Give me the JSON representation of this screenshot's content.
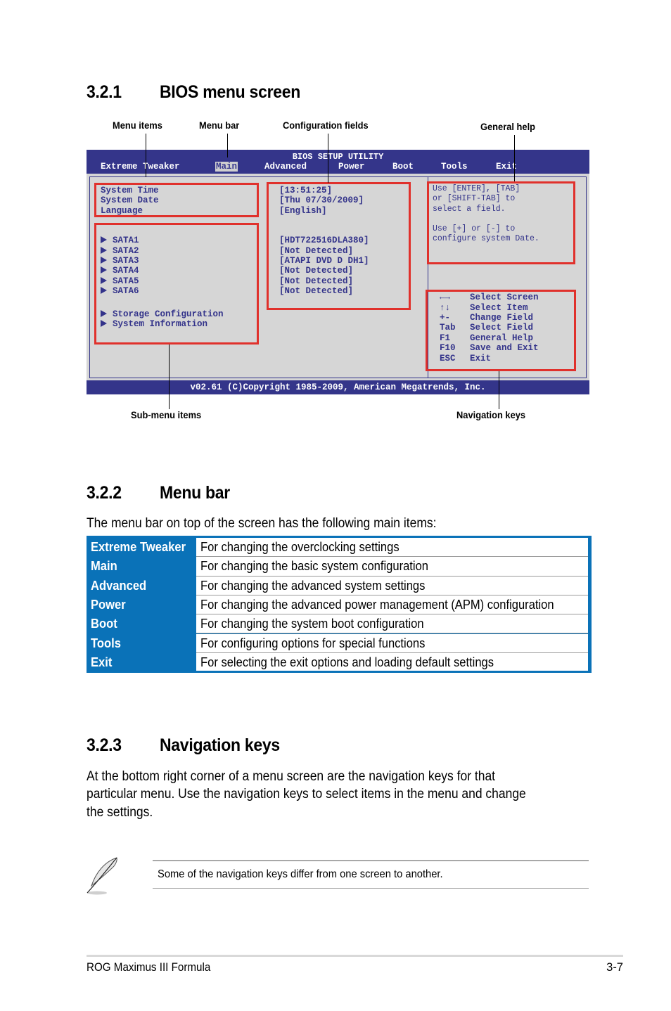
{
  "sections": {
    "bios_menu_screen": {
      "number": "3.2.1",
      "title": "BIOS menu screen"
    },
    "menu_bar": {
      "number": "3.2.2",
      "title": "Menu bar"
    },
    "navigation_keys": {
      "number": "3.2.3",
      "title": "Navigation keys"
    }
  },
  "callouts": {
    "menu_items": "Menu items",
    "menu_bar": "Menu bar",
    "configuration_fields": "Configuration fields",
    "general_help": "General help",
    "sub_menu_items": "Sub-menu items",
    "navigation_keys": "Navigation keys"
  },
  "bios": {
    "title": "BIOS SETUP UTILITY",
    "menu": [
      "Extreme Tweaker",
      "Main",
      "Advanced",
      "Power",
      "Boot",
      "Tools",
      "Exit"
    ],
    "active_menu": "Main",
    "menu_items": [
      "System Time",
      "System Date",
      "Language"
    ],
    "sub_menu_items": [
      "SATA1",
      "SATA2",
      "SATA3",
      "SATA4",
      "SATA5",
      "SATA6"
    ],
    "sub_menu_items_2": [
      "Storage Configuration",
      "System Information"
    ],
    "config_values": [
      "[13:51:25]",
      "[Thu 07/30/2009]",
      "[English]"
    ],
    "sata_values": [
      "[HDT722516DLA380]",
      "[Not Detected]",
      "[ATAPI DVD D DH1]",
      "[Not Detected]",
      "[Not Detected]",
      "[Not Detected]"
    ],
    "general_help": [
      "Use [ENTER], [TAB]",
      "or [SHIFT-TAB] to",
      "select a field.",
      "",
      "Use [+] or [-] to",
      "configure system Date."
    ],
    "nav_keys": [
      {
        "key": "←→",
        "action": "Select Screen"
      },
      {
        "key": "↑↓",
        "action": "Select Item"
      },
      {
        "key": "+-",
        "action": "Change Field"
      },
      {
        "key": "Tab",
        "action": "Select Field"
      },
      {
        "key": "F1",
        "action": "General Help"
      },
      {
        "key": "F10",
        "action": "Save and Exit"
      },
      {
        "key": "ESC",
        "action": "Exit"
      }
    ],
    "footer": "v02.61 (C)Copyright 1985-2009, American Megatrends, Inc."
  },
  "menu_bar_intro": "The menu bar on top of the screen has the following main items:",
  "menu_table": [
    {
      "item": "Extreme Tweaker",
      "description": "For changing the overclocking settings"
    },
    {
      "item": "Main",
      "description": "For changing the basic system configuration"
    },
    {
      "item": "Advanced",
      "description": "For changing the advanced system settings"
    },
    {
      "item": "Power",
      "description": "For changing the advanced power management (APM) configuration"
    },
    {
      "item": "Boot",
      "description": "For changing the system boot configuration"
    },
    {
      "item": "Tools",
      "description": "For configuring options for special functions"
    },
    {
      "item": "Exit",
      "description": "For selecting the exit options and loading default settings"
    }
  ],
  "navigation_paragraph": [
    "At the bottom right corner of a menu screen are the navigation keys for that",
    "particular menu. Use the navigation keys to select items in the menu and change",
    "the settings."
  ],
  "note": {
    "icon": "feather-pen-icon",
    "text": "Some of the navigation keys differ from one screen to another."
  },
  "footer": {
    "product": "ROG Maximus III Formula",
    "page": "3-7"
  },
  "colors": {
    "bios_blue": "#34358a",
    "bios_gray": "#d6d6d6",
    "highlight_red": "#e0312c",
    "table_blue": "#0a72b8"
  }
}
